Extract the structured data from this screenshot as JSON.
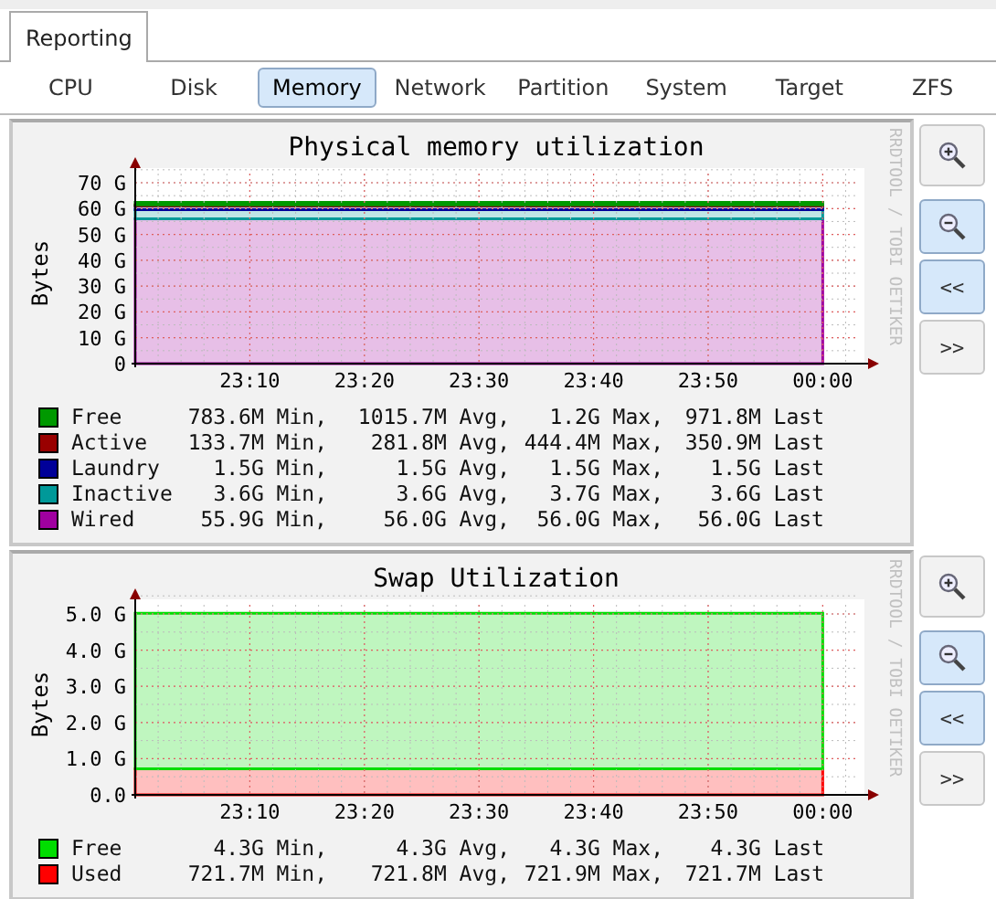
{
  "tabs": [
    {
      "label": "Reporting",
      "selected": true
    }
  ],
  "subtabs": [
    {
      "label": "CPU",
      "selected": false
    },
    {
      "label": "Disk",
      "selected": false
    },
    {
      "label": "Memory",
      "selected": true
    },
    {
      "label": "Network",
      "selected": false
    },
    {
      "label": "Partition",
      "selected": false
    },
    {
      "label": "System",
      "selected": false
    },
    {
      "label": "Target",
      "selected": false
    },
    {
      "label": "ZFS",
      "selected": false
    }
  ],
  "graphs": [
    {
      "watermark": "RRDTOOL / TOBI OETIKER",
      "chart_data": {
        "type": "area",
        "stacked": true,
        "grid": true,
        "title": "Physical memory utilization",
        "ylabel": "Bytes",
        "categories": [
          null,
          "23:10",
          "23:20",
          "23:30",
          "23:40",
          "23:50",
          "00:00"
        ],
        "ylim": [
          0,
          70
        ],
        "yticks": [
          {
            "value": 0,
            "label": "0"
          },
          {
            "value": 10,
            "label": "10 G"
          },
          {
            "value": 20,
            "label": "20 G"
          },
          {
            "value": 30,
            "label": "30 G"
          },
          {
            "value": 40,
            "label": "40 G"
          },
          {
            "value": 50,
            "label": "50 G"
          },
          {
            "value": 60,
            "label": "60 G"
          },
          {
            "value": 70,
            "label": "70 G"
          }
        ],
        "series": [
          {
            "name": "Wired",
            "color": "#a000a0",
            "values": [
              56.0,
              56.0,
              56.0,
              56.0,
              56.0,
              56.0,
              56.0
            ]
          },
          {
            "name": "Inactive",
            "color": "#009999",
            "values": [
              3.6,
              3.6,
              3.6,
              3.6,
              3.6,
              3.6,
              3.6
            ]
          },
          {
            "name": "Laundry",
            "color": "#000099",
            "values": [
              1.5,
              1.5,
              1.5,
              1.5,
              1.5,
              1.5,
              1.5
            ]
          },
          {
            "name": "Active",
            "color": "#990000",
            "values": [
              0.3,
              0.3,
              0.3,
              0.3,
              0.3,
              0.3,
              0.3
            ]
          },
          {
            "name": "Free",
            "color": "#009900",
            "values": [
              1.0,
              1.0,
              1.0,
              1.0,
              1.0,
              1.0,
              1.0
            ]
          }
        ]
      },
      "legend_stats": [
        {
          "min": "783.6M Min,",
          "avg": "1015.7M Avg,",
          "max": "1.2G Max,",
          "last": "971.8M Last"
        },
        {
          "min": "133.7M Min,",
          "avg": "281.8M Avg,",
          "max": "444.4M Max,",
          "last": "350.9M Last"
        },
        {
          "min": "1.5G Min,",
          "avg": "1.5G Avg,",
          "max": "1.5G Max,",
          "last": "1.5G Last"
        },
        {
          "min": "3.6G Min,",
          "avg": "3.6G Avg,",
          "max": "3.7G Max,",
          "last": "3.6G Last"
        },
        {
          "min": "55.9G Min,",
          "avg": "56.0G Avg,",
          "max": "56.0G Max,",
          "last": "56.0G Last"
        }
      ],
      "buttons": [
        {
          "kind": "zoom-in",
          "active": false
        },
        {
          "kind": "zoom-out",
          "active": true
        },
        {
          "kind": "text",
          "label": "<<",
          "active": true
        },
        {
          "kind": "text",
          "label": ">>",
          "active": false
        }
      ]
    },
    {
      "watermark": "RRDTOOL / TOBI OETIKER",
      "chart_data": {
        "type": "area",
        "stacked": true,
        "grid": true,
        "title": "Swap Utilization",
        "ylabel": "Bytes",
        "categories": [
          null,
          "23:10",
          "23:20",
          "23:30",
          "23:40",
          "23:50",
          "00:00"
        ],
        "ylim": [
          0,
          5.0
        ],
        "yticks": [
          {
            "value": 0,
            "label": "0.0"
          },
          {
            "value": 1,
            "label": "1.0 G"
          },
          {
            "value": 2,
            "label": "2.0 G"
          },
          {
            "value": 3,
            "label": "3.0 G"
          },
          {
            "value": 4,
            "label": "4.0 G"
          },
          {
            "value": 5,
            "label": "5.0 G"
          }
        ],
        "series": [
          {
            "name": "Used",
            "color": "#ff0000",
            "values": [
              0.72,
              0.72,
              0.72,
              0.72,
              0.72,
              0.72,
              0.72
            ]
          },
          {
            "name": "Free",
            "color": "#00dd00",
            "values": [
              4.3,
              4.3,
              4.3,
              4.3,
              4.3,
              4.3,
              4.3
            ]
          }
        ]
      },
      "legend_stats": [
        {
          "min": "4.3G Min,",
          "avg": "4.3G Avg,",
          "max": "4.3G Max,",
          "last": "4.3G Last"
        },
        {
          "min": "721.7M Min,",
          "avg": "721.8M Avg,",
          "max": "721.9M Max,",
          "last": "721.7M Last"
        }
      ],
      "buttons": [
        {
          "kind": "zoom-in",
          "active": false
        },
        {
          "kind": "zoom-out",
          "active": true
        },
        {
          "kind": "text",
          "label": "<<",
          "active": true
        },
        {
          "kind": "text",
          "label": ">>",
          "active": false
        }
      ]
    }
  ]
}
